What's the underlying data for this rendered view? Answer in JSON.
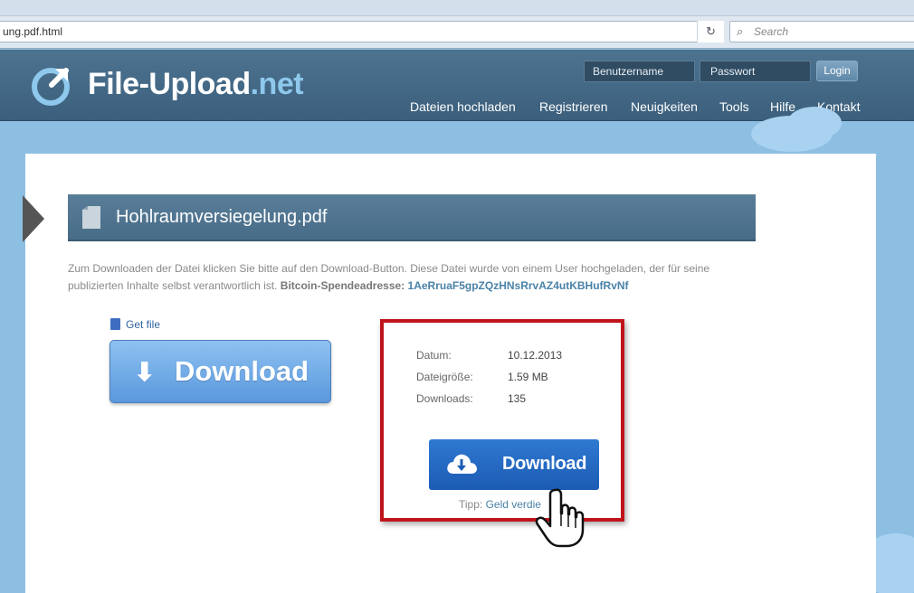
{
  "browser": {
    "url": "ung.pdf.html",
    "search_placeholder": "Search",
    "reload_icon": "reload-icon",
    "search_icon": "search-icon"
  },
  "header": {
    "logo_main": "File-Upload",
    "logo_tld": ".net",
    "login_user_placeholder": "Benutzername",
    "login_pass_placeholder": "Passwort",
    "login_button": "Login",
    "nav": [
      "Dateien hochladen",
      "Registrieren",
      "Neuigkeiten",
      "Tools",
      "Hilfe",
      "Kontakt"
    ]
  },
  "file": {
    "name": "Hohlraumversiegelung.pdf",
    "description": "Zum Downloaden der Datei klicken Sie bitte auf den Download-Button. Diese Datei wurde von einem User hochgeladen, der für seine publizierten Inhalte selbst verantwortlich ist.",
    "bitcoin_label": "Bitcoin-Spendeadresse:",
    "bitcoin_address": "1AeRruaF5gpZQzHNsRrvAZ4utKBHufRvNf"
  },
  "left_download": {
    "get_file": "Get file",
    "label": "Download"
  },
  "info": {
    "datum_label": "Datum:",
    "datum_value": "10.12.2013",
    "size_label": "Dateigröße:",
    "size_value": "1.59 MB",
    "downloads_label": "Downloads:",
    "downloads_value": "135",
    "download_button": "Download",
    "tipp_label": "Tipp:",
    "tipp_link": "Geld verdie"
  },
  "colors": {
    "header": "#476c88",
    "accent_blue": "#1c5bb4",
    "highlight_red": "#c0141b",
    "background": "#8dbfe3"
  }
}
